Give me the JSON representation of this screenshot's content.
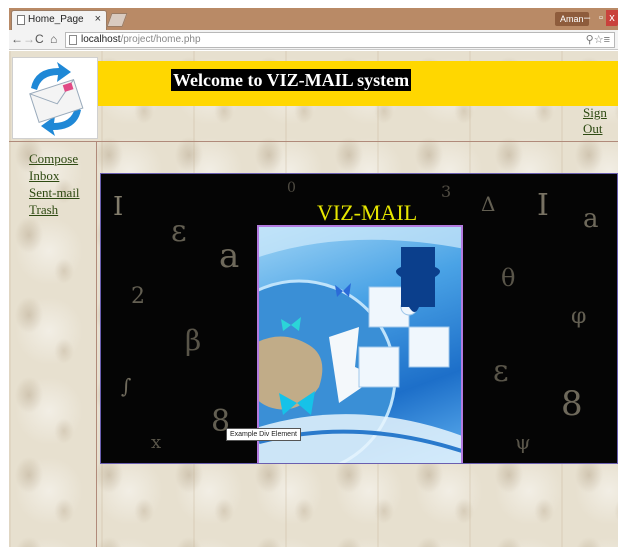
{
  "browser": {
    "tab_title": "Home_Page",
    "tab_close": "×",
    "user_badge": "Aman",
    "win_min": "–",
    "win_max": "▫",
    "win_close": "x",
    "url_host": "localhost",
    "url_path": "/project/home.php",
    "nav_icons": [
      "back-icon",
      "forward-icon",
      "reload-icon",
      "home-icon"
    ]
  },
  "header": {
    "welcome": "Welcome to VIZ-MAIL system",
    "signout": "Sign Out",
    "band_color": "#ffd700"
  },
  "sidebar": {
    "items": [
      {
        "label": "Compose"
      },
      {
        "label": "Inbox"
      },
      {
        "label": "Sent-mail"
      },
      {
        "label": "Trash"
      }
    ]
  },
  "banner": {
    "title": "VIZ-MAIL",
    "tooltip": "Example Div Element"
  },
  "colors": {
    "link": "#2e4a12",
    "banner_title": "#e6e600",
    "puzzle_border": "#b37be0"
  }
}
